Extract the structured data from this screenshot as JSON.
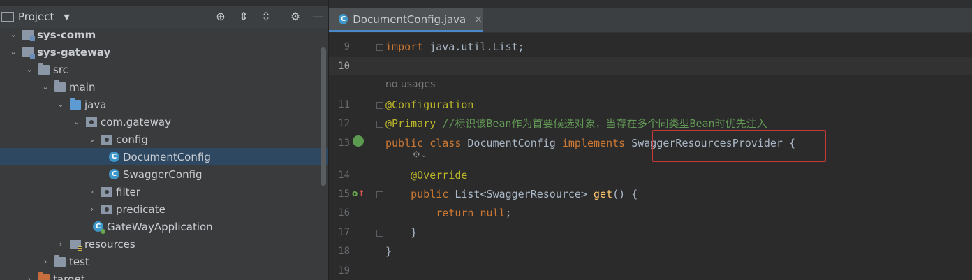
{
  "project_panel": {
    "title": "Project",
    "tree": [
      {
        "label": "sys-comm",
        "depth": 0,
        "expanded": true,
        "icon": "module-icon",
        "bold": true
      },
      {
        "label": "sys-gateway",
        "depth": 0,
        "expanded": true,
        "icon": "module-icon",
        "bold": true
      },
      {
        "label": "src",
        "depth": 1,
        "expanded": true,
        "icon": "folder-icon"
      },
      {
        "label": "main",
        "depth": 2,
        "expanded": true,
        "icon": "folder-icon"
      },
      {
        "label": "java",
        "depth": 3,
        "expanded": true,
        "icon": "source-folder-icon"
      },
      {
        "label": "com.gateway",
        "depth": 4,
        "expanded": true,
        "icon": "package-icon"
      },
      {
        "label": "config",
        "depth": 5,
        "expanded": true,
        "icon": "package-icon"
      },
      {
        "label": "DocumentConfig",
        "depth": 6,
        "icon": "class-icon",
        "selected": true
      },
      {
        "label": "SwaggerConfig",
        "depth": 6,
        "icon": "class-icon"
      },
      {
        "label": "filter",
        "depth": 5,
        "expanded": false,
        "icon": "package-icon"
      },
      {
        "label": "predicate",
        "depth": 5,
        "expanded": false,
        "icon": "package-icon"
      },
      {
        "label": "GateWayApplication",
        "depth": 5,
        "icon": "spring-app-icon"
      },
      {
        "label": "resources",
        "depth": 3,
        "expanded": false,
        "icon": "resources-folder-icon"
      },
      {
        "label": "test",
        "depth": 2,
        "expanded": false,
        "icon": "folder-icon"
      },
      {
        "label": "target",
        "depth": 1,
        "expanded": false,
        "icon": "excluded-folder-icon"
      }
    ]
  },
  "editor": {
    "tab": {
      "label": "DocumentConfig.java",
      "close": "×"
    },
    "usage_hint": "no usages",
    "lines": [
      {
        "n": "9",
        "code": "import java.util.List;"
      },
      {
        "n": "10",
        "code": ""
      },
      {
        "n": "11",
        "code": "@Configuration"
      },
      {
        "n": "12",
        "code": "@Primary //标识该Bean作为首要候选对象，当存在多个同类型Bean时优先注入"
      },
      {
        "n": "13",
        "code": "public class DocumentConfig implements SwaggerResourcesProvider {"
      },
      {
        "n": "14",
        "code": "    @Override"
      },
      {
        "n": "15",
        "code": "    public List<SwaggerResource> get() {"
      },
      {
        "n": "16",
        "code": "        return null;"
      },
      {
        "n": "17",
        "code": "    }"
      },
      {
        "n": "18",
        "code": "}"
      },
      {
        "n": "19",
        "code": ""
      }
    ],
    "highlight_box_target": "SwaggerResourcesProvider",
    "colors": {
      "keyword": "#cc7832",
      "annotation": "#bbb529",
      "comment": "#629755",
      "method": "#ffc66d",
      "highlight_box": "#c63a3a"
    }
  }
}
